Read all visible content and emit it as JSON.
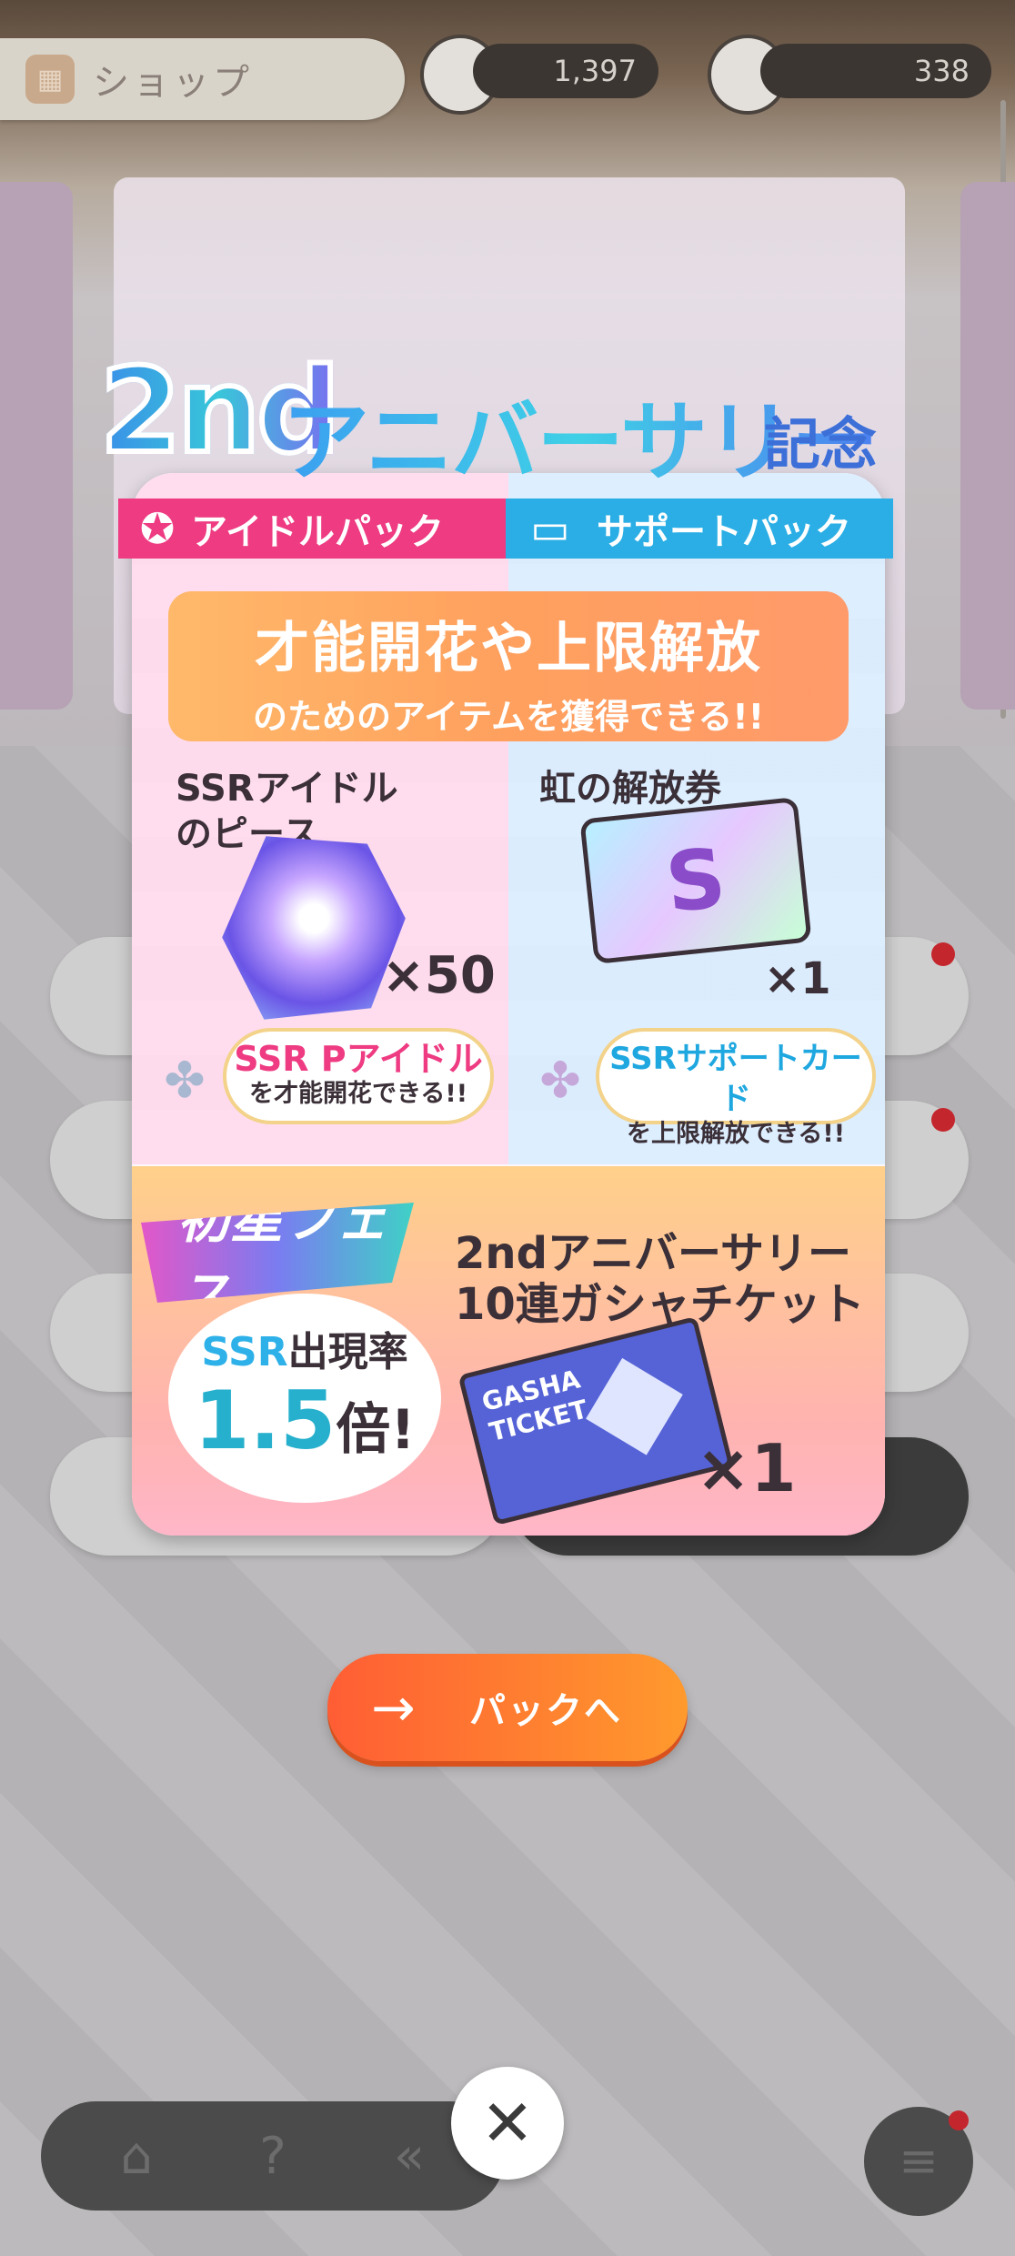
{
  "header": {
    "title": "ショップ",
    "currency_1": "1,397",
    "currency_2": "338"
  },
  "modal": {
    "title_2nd": "2nd",
    "title_anniversary": "アニバーサリー",
    "title_suffix": "記念",
    "tabs": {
      "idol_pack": "アイドルパック",
      "support_pack": "サポートパック"
    },
    "headline": {
      "line1": "才能開花や上限解放",
      "line2": "のためのアイテムを獲得できる!!"
    },
    "items": [
      {
        "name_line1": "SSRアイドル",
        "name_line2": "のピース",
        "quantity": "×50",
        "bubble_title": "SSR Pアイドル",
        "bubble_sub": "を才能開花できる!!"
      },
      {
        "name_line1": "虹の解放券",
        "name_line2": "",
        "quantity": "×1",
        "bubble_title": "SSRサポートカード",
        "bubble_sub": "を上限解放できる!!"
      }
    ],
    "fes": {
      "logo": "初星フェス",
      "rate_prefix": "SSR",
      "rate_label": "出現率",
      "rate_value": "1.5",
      "rate_suffix": "倍!"
    },
    "gacha_ticket": {
      "name_line1": "2ndアニバーサリー",
      "name_line2": "10連ガシャチケット",
      "ticket_text": "GASHA TICKET",
      "quantity": "×1"
    }
  },
  "actions": {
    "pack_button_label": "パックへ"
  },
  "icons": {
    "arrow": "arrow-right-icon",
    "close": "close-icon",
    "home": "home-icon",
    "back": "back-icon",
    "menu": "menu-icon"
  },
  "colors": {
    "cta_start": "#ff5d34",
    "cta_end": "#ff9a2d",
    "idol_tab": "#ee3b82",
    "support_tab": "#2aaee5"
  }
}
